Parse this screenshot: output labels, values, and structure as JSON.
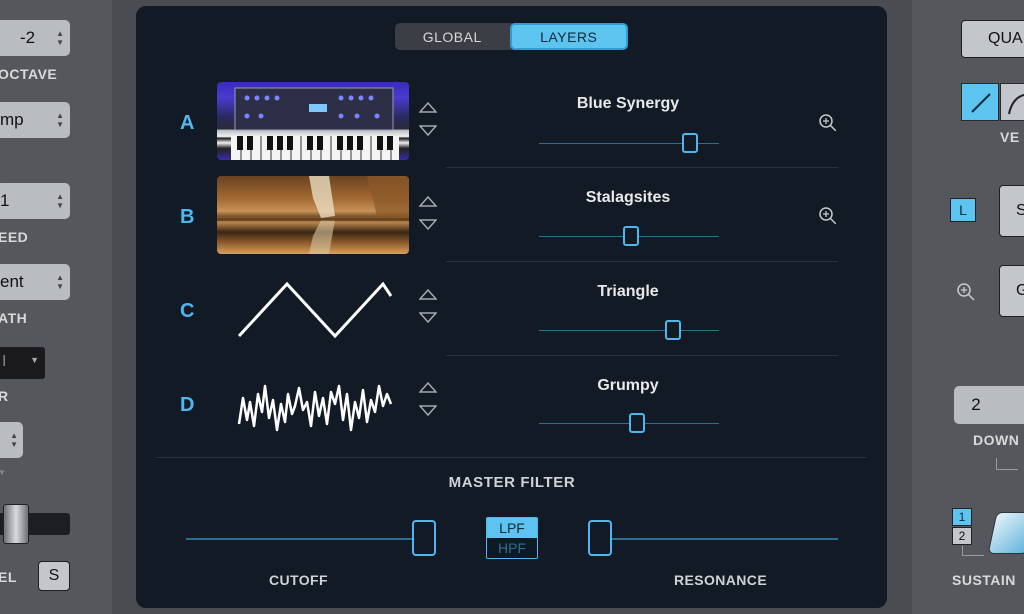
{
  "left_panel": {
    "octave_value": "-2",
    "octave_label": "OCTAVE",
    "mode_value": "mp",
    "speed_value": "1",
    "speed_label": "EED",
    "path_value": "ent",
    "path_label": "ATH",
    "dark_select_value": "I",
    "r_label": "R",
    "level_label": "EL",
    "s_button": "S"
  },
  "right_panel": {
    "qua_button": "QUA",
    "ve_label": "VE",
    "l_badge": "L",
    "s_button": "S",
    "g_button": "G",
    "down_value": "2",
    "down_label": "DOWN",
    "sustain_1": "1",
    "sustain_2": "2",
    "sustain_label": "SUSTAIN"
  },
  "tabs": [
    {
      "label": "GLOBAL",
      "active": false
    },
    {
      "label": "LAYERS",
      "active": true
    }
  ],
  "layers": [
    {
      "letter": "A",
      "name": "Blue Synergy",
      "thumb": "synth-photo",
      "level": 0.84
    },
    {
      "letter": "B",
      "name": "Stalagsites",
      "thumb": "cave-photo",
      "level": 0.51
    },
    {
      "letter": "C",
      "name": "Triangle",
      "thumb": "triangle-wave",
      "level": 0.75
    },
    {
      "letter": "D",
      "name": "Grumpy",
      "thumb": "noisy-wave",
      "level": 0.55
    }
  ],
  "master_filter": {
    "title": "MASTER FILTER",
    "cutoff_label": "CUTOFF",
    "resonance_label": "RESONANCE",
    "lpf_label": "LPF",
    "hpf_label": "HPF",
    "selected": "LPF",
    "cutoff_level": 1.0,
    "resonance_level": 0.0
  },
  "colors": {
    "accent": "#4fb6ef",
    "panel_bg": "#111a25",
    "body_bg": "#4a4c51"
  }
}
